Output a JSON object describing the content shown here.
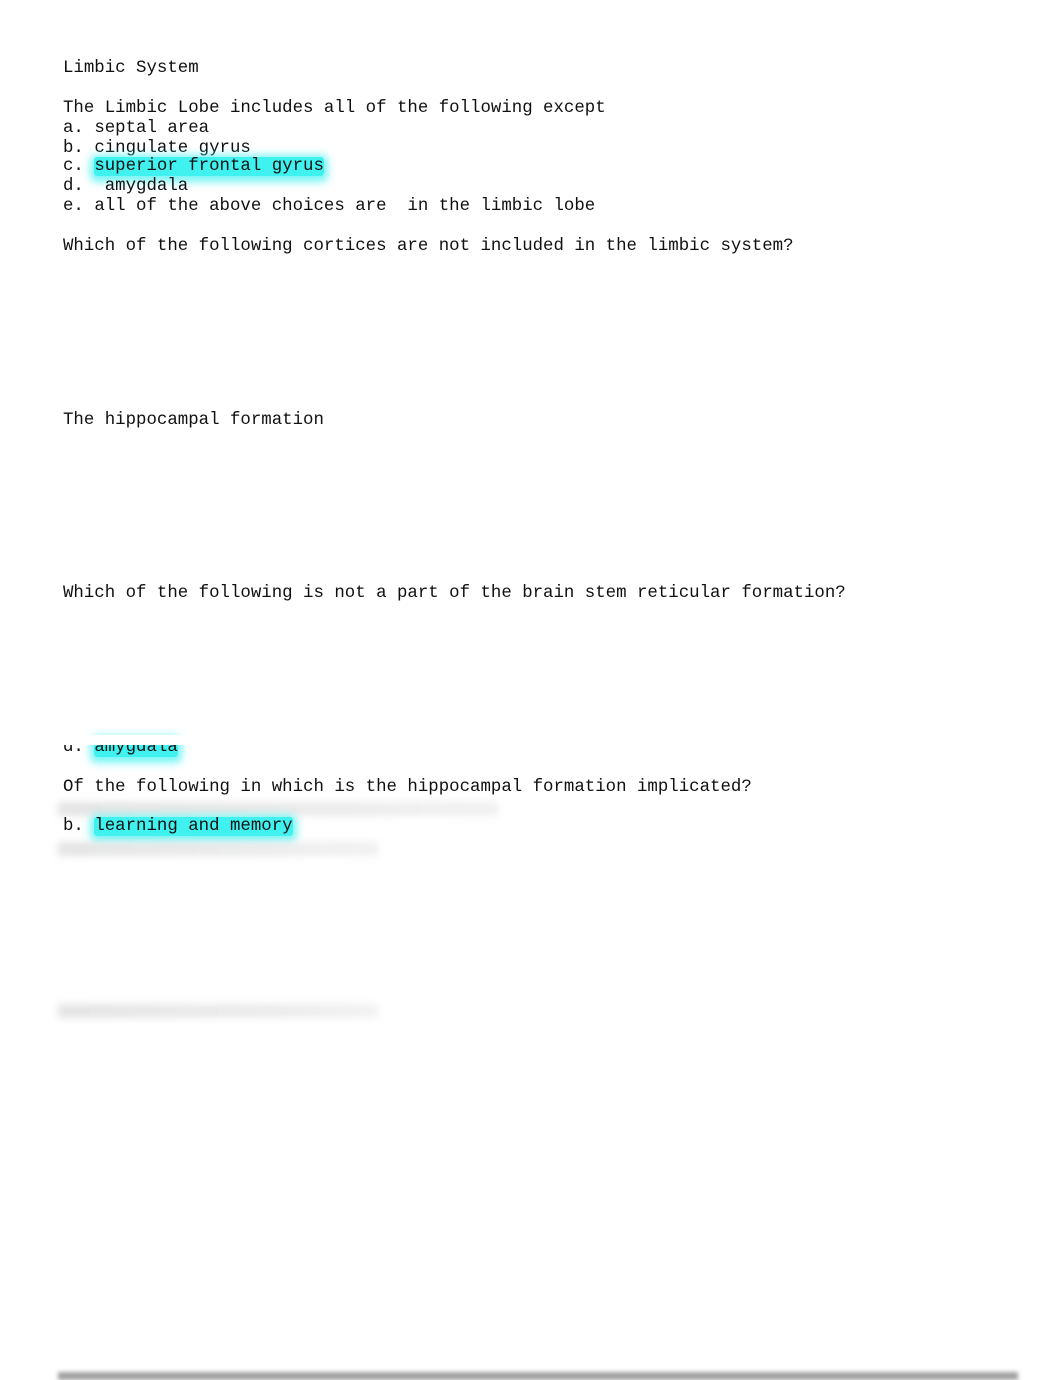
{
  "title": "Limbic System",
  "q1": {
    "question": "The Limbic Lobe includes all of the following except",
    "options": [
      {
        "prefix": "a. ",
        "text": "septal area",
        "highlighted": false
      },
      {
        "prefix": "b. ",
        "text": "cingulate gyrus",
        "highlighted": false
      },
      {
        "prefix": "c. ",
        "text": "superior frontal gyrus",
        "highlighted": true
      },
      {
        "prefix": "d.  ",
        "text": "amygdala",
        "highlighted": false
      },
      {
        "prefix": "e. ",
        "text": "all of the above choices are  in the limbic lobe",
        "highlighted": false
      }
    ]
  },
  "q2": {
    "question": "Which of the following cortices are not included in the limbic system?"
  },
  "q3": {
    "question": "The hippocampal formation"
  },
  "q4": {
    "question": "Which of the following is not a part of the brain stem reticular formation?",
    "answer_prefix": "d. ",
    "answer": "amygdala"
  },
  "q5": {
    "question": "Of the following in which is the hippocampal formation implicated?",
    "answer_prefix": "b. ",
    "answer": "learning and memory"
  },
  "highlight_color": "#3ff2f0"
}
